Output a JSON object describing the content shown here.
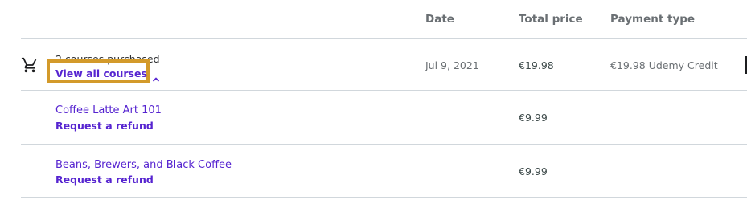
{
  "header": {
    "date": "Date",
    "total_price": "Total price",
    "payment_type": "Payment type"
  },
  "purchase": {
    "icon": "cart-icon",
    "summary": "2 courses purchased",
    "toggle_label": "View all courses",
    "toggle_icon": "chevron-up-icon",
    "date": "Jul 9, 2021",
    "total": "€19.98",
    "payment": "€19.98 Udemy Credit"
  },
  "courses": [
    {
      "title": "Coffee Latte Art 101",
      "refund_label": "Request a refund",
      "price": "€9.99"
    },
    {
      "title": "Beans, Brewers, and Black Coffee",
      "refund_label": "Request a refund",
      "price": "€9.99"
    }
  ],
  "colors": {
    "accent": "#5624d0",
    "highlight": "#d39a2a"
  }
}
